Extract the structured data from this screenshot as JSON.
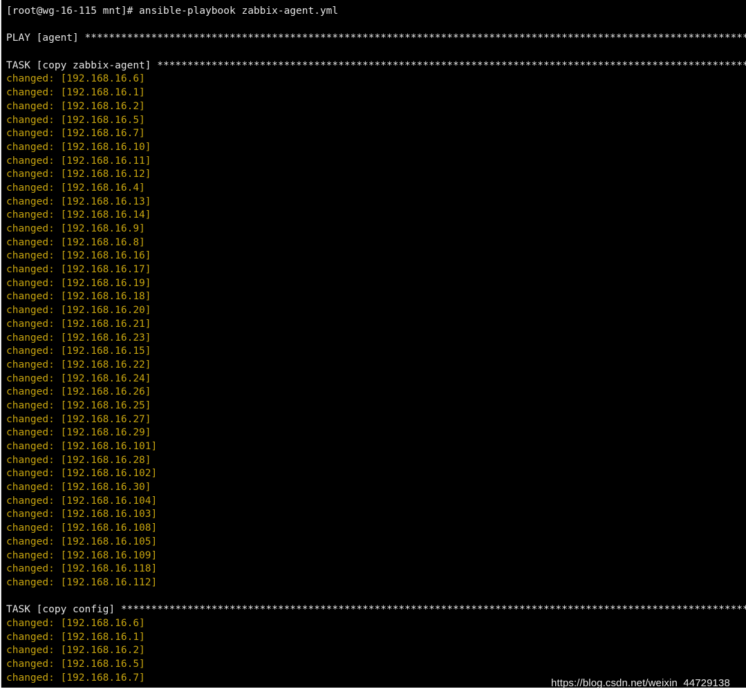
{
  "terminal": {
    "prompt": "[root@wg-16-115 mnt]# ansible-playbook zabbix-agent.yml",
    "play_header": "PLAY [agent] **********************************************************************************************************************",
    "task1_header": "TASK [copy zabbix-agent] **********************************************************************************************************",
    "task1_results": [
      "changed: [192.168.16.6]",
      "changed: [192.168.16.1]",
      "changed: [192.168.16.2]",
      "changed: [192.168.16.5]",
      "changed: [192.168.16.7]",
      "changed: [192.168.16.10]",
      "changed: [192.168.16.11]",
      "changed: [192.168.16.12]",
      "changed: [192.168.16.4]",
      "changed: [192.168.16.13]",
      "changed: [192.168.16.14]",
      "changed: [192.168.16.9]",
      "changed: [192.168.16.8]",
      "changed: [192.168.16.16]",
      "changed: [192.168.16.17]",
      "changed: [192.168.16.19]",
      "changed: [192.168.16.18]",
      "changed: [192.168.16.20]",
      "changed: [192.168.16.21]",
      "changed: [192.168.16.23]",
      "changed: [192.168.16.15]",
      "changed: [192.168.16.22]",
      "changed: [192.168.16.24]",
      "changed: [192.168.16.26]",
      "changed: [192.168.16.25]",
      "changed: [192.168.16.27]",
      "changed: [192.168.16.29]",
      "changed: [192.168.16.101]",
      "changed: [192.168.16.28]",
      "changed: [192.168.16.102]",
      "changed: [192.168.16.30]",
      "changed: [192.168.16.104]",
      "changed: [192.168.16.103]",
      "changed: [192.168.16.108]",
      "changed: [192.168.16.105]",
      "changed: [192.168.16.109]",
      "changed: [192.168.16.118]",
      "changed: [192.168.16.112]"
    ],
    "task2_header": "TASK [copy config] ************************************************************************************************************",
    "task2_results": [
      "changed: [192.168.16.6]",
      "changed: [192.168.16.1]",
      "changed: [192.168.16.2]",
      "changed: [192.168.16.5]",
      "changed: [192.168.16.7]"
    ]
  },
  "watermark": "https://blog.csdn.net/weixin_44729138",
  "colors": {
    "background": "#000000",
    "text": "#e6e6e6",
    "changed": "#c8a50f"
  }
}
